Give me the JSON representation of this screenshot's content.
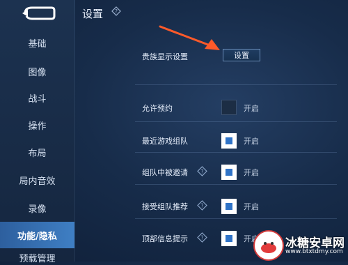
{
  "header": {
    "title": "设置"
  },
  "sidebar": {
    "items": [
      {
        "label": "基础"
      },
      {
        "label": "图像"
      },
      {
        "label": "战斗"
      },
      {
        "label": "操作"
      },
      {
        "label": "布局"
      },
      {
        "label": "局内音效"
      },
      {
        "label": "录像"
      },
      {
        "label": "功能/隐私",
        "active": true
      },
      {
        "label": "预载管理"
      }
    ]
  },
  "main": {
    "noble_display": {
      "label": "贵族显示设置",
      "button_label": "设置"
    },
    "rows": [
      {
        "label": "允许预约",
        "toggle_label": "开启",
        "checked": false,
        "help": false
      },
      {
        "label": "最近游戏组队",
        "toggle_label": "开启",
        "checked": true,
        "help": false
      },
      {
        "label": "组队中被邀请",
        "toggle_label": "开启",
        "checked": true,
        "help": true
      },
      {
        "label": "接受组队推荐",
        "toggle_label": "开启",
        "checked": true,
        "help": true
      },
      {
        "label": "顶部信息提示",
        "toggle_label": "开启",
        "checked": true,
        "help": true
      }
    ]
  },
  "watermark": {
    "title": "冰糖安卓网",
    "url": "www.btxtdmy.com"
  },
  "colors": {
    "accent": "#2f73c7",
    "arrow": "#ff5a2a",
    "active_nav": "#3f7fc4"
  }
}
